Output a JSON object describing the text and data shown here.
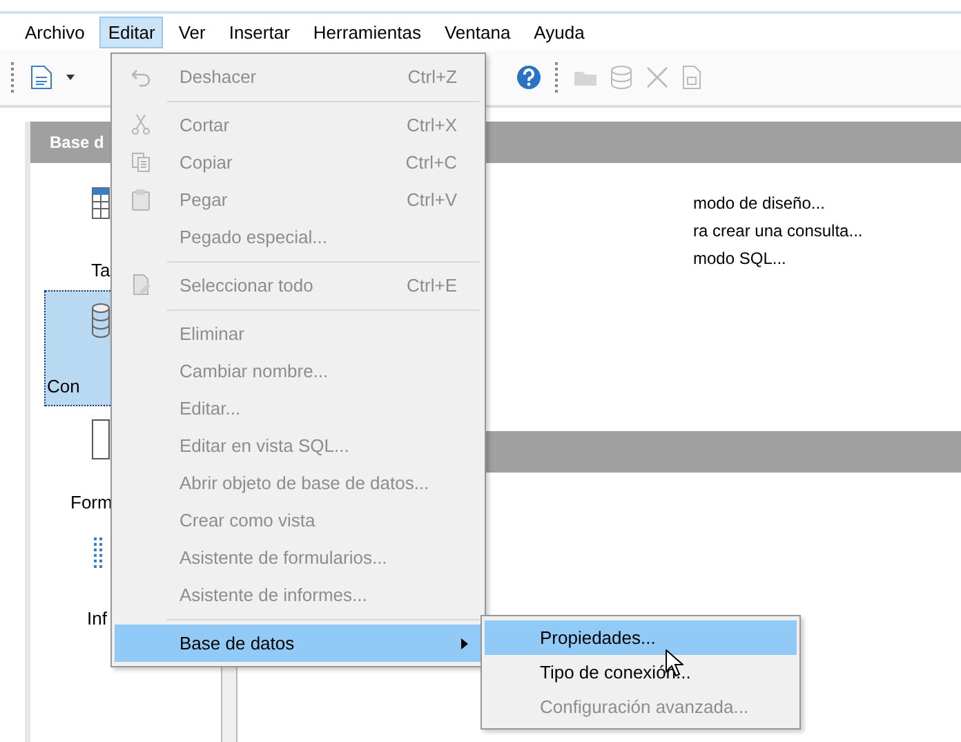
{
  "menubar": [
    {
      "label": "Archivo",
      "selected": false
    },
    {
      "label": "Editar",
      "selected": true
    },
    {
      "label": "Ver",
      "selected": false
    },
    {
      "label": "Insertar",
      "selected": false
    },
    {
      "label": "Herramientas",
      "selected": false
    },
    {
      "label": "Ventana",
      "selected": false
    },
    {
      "label": "Ayuda",
      "selected": false
    }
  ],
  "panel": {
    "header": "Base d",
    "second_header_visible": true
  },
  "sidebar": {
    "items": [
      {
        "label": "Ta",
        "selected": false
      },
      {
        "label": "Con",
        "selected": true
      },
      {
        "label": "Form",
        "selected": false
      },
      {
        "label": "Inf",
        "selected": false
      }
    ]
  },
  "tasks": [
    "modo de diseño...",
    "ra crear una consulta...",
    "modo SQL..."
  ],
  "edit_menu": [
    {
      "kind": "item",
      "label": "Deshacer",
      "shortcut": "Ctrl+Z",
      "disabled": true,
      "selected": false
    },
    {
      "kind": "separator"
    },
    {
      "kind": "item",
      "label": "Cortar",
      "shortcut": "Ctrl+X",
      "disabled": true,
      "selected": false
    },
    {
      "kind": "item",
      "label": "Copiar",
      "shortcut": "Ctrl+C",
      "disabled": true,
      "selected": false
    },
    {
      "kind": "item",
      "label": "Pegar",
      "shortcut": "Ctrl+V",
      "disabled": true,
      "selected": false
    },
    {
      "kind": "item",
      "label": "Pegado especial...",
      "disabled": true,
      "selected": false
    },
    {
      "kind": "separator"
    },
    {
      "kind": "item",
      "label": "Seleccionar todo",
      "shortcut": "Ctrl+E",
      "disabled": true,
      "selected": false
    },
    {
      "kind": "separator"
    },
    {
      "kind": "item",
      "label": "Eliminar",
      "disabled": true,
      "selected": false
    },
    {
      "kind": "item",
      "label": "Cambiar nombre...",
      "disabled": true,
      "selected": false
    },
    {
      "kind": "item",
      "label": "Editar...",
      "disabled": true,
      "selected": false
    },
    {
      "kind": "item",
      "label": "Editar en vista SQL...",
      "disabled": true,
      "selected": false
    },
    {
      "kind": "item",
      "label": "Abrir objeto de base de datos...",
      "disabled": true,
      "selected": false
    },
    {
      "kind": "item",
      "label": "Crear como vista",
      "disabled": true,
      "selected": false
    },
    {
      "kind": "item",
      "label": "Asistente de formularios...",
      "disabled": true,
      "selected": false
    },
    {
      "kind": "item",
      "label": "Asistente de informes...",
      "disabled": true,
      "selected": false
    },
    {
      "kind": "separator"
    },
    {
      "kind": "submenu",
      "label": "Base de datos",
      "disabled": false,
      "selected": true
    }
  ],
  "submenu": [
    {
      "label": "Propiedades...",
      "disabled": false,
      "selected": true
    },
    {
      "label": "Tipo de conexión...",
      "disabled": false,
      "selected": false
    },
    {
      "label": "Configuración avanzada...",
      "disabled": true,
      "selected": false
    }
  ]
}
